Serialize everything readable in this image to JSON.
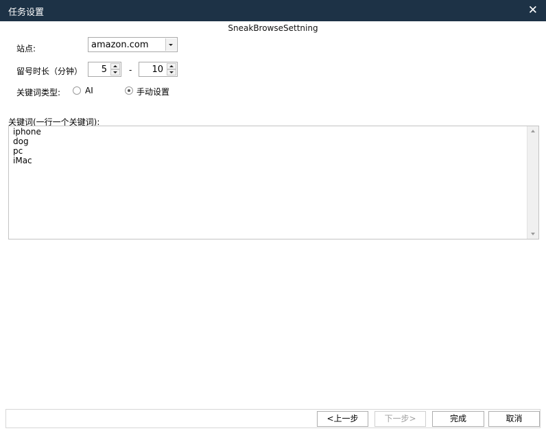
{
  "window": {
    "title": "任务设置",
    "close_glyph": "✕"
  },
  "heading": "SneakBrowseSettning",
  "site": {
    "label": "站点:",
    "value": "amazon.com"
  },
  "stay_duration": {
    "label": "留号时长（分钟）",
    "min": "5",
    "separator": "-",
    "max": "10"
  },
  "keyword_type": {
    "label": "关键词类型:",
    "options": [
      "AI",
      "手动设置"
    ],
    "selected": "手动设置"
  },
  "keywords": {
    "label": "关键词(一行一个关键词):",
    "lines": [
      "iphone",
      "dog",
      "pc",
      "iMac"
    ]
  },
  "footer": {
    "prev": "<上一步",
    "next": "下一步>",
    "finish": "完成",
    "cancel": "取消"
  }
}
